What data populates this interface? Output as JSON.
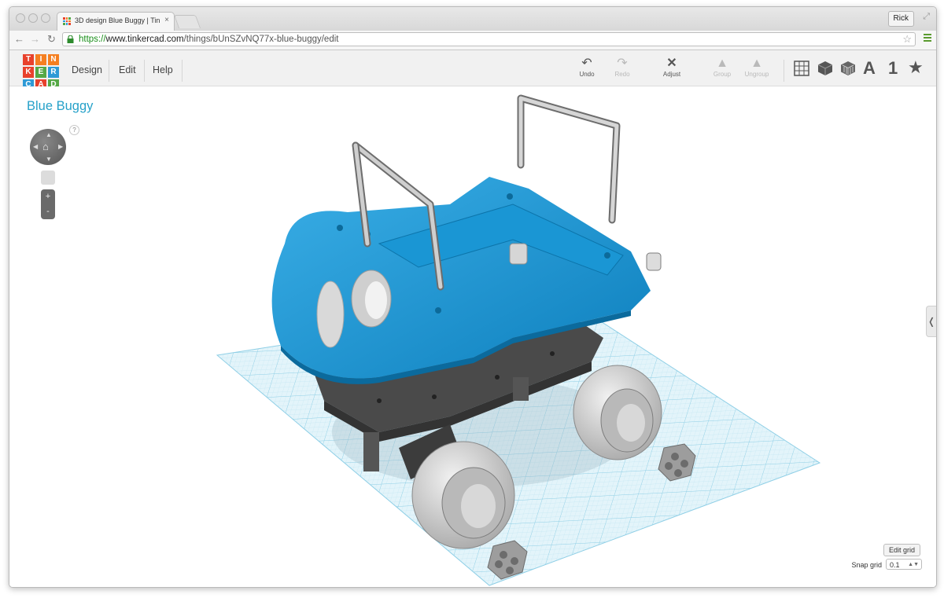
{
  "browser": {
    "tab_title": "3D design Blue Buggy | Tin",
    "tab_close": "×",
    "user": "Rick",
    "url_scheme": "https://",
    "url_host": "www.tinkercad.com",
    "url_path": "/things/bUnSZvNQ77x-blue-buggy/edit"
  },
  "logo": {
    "letters": [
      "T",
      "I",
      "N",
      "K",
      "E",
      "R",
      "C",
      "A",
      "D"
    ],
    "colors": [
      "#e8412c",
      "#f57f21",
      "#f57f21",
      "#e8412c",
      "#55a845",
      "#2e9ad6",
      "#2e9ad6",
      "#e8412c",
      "#55a845"
    ]
  },
  "menu": {
    "design": "Design",
    "edit": "Edit",
    "help": "Help"
  },
  "tools": {
    "undo": "Undo",
    "redo": "Redo",
    "adjust": "Adjust",
    "group": "Group",
    "ungroup": "Ungroup"
  },
  "view_tools": {
    "text_tool": "A",
    "number_tool": "1"
  },
  "design": {
    "title": "Blue Buggy"
  },
  "viewport": {
    "help": "?",
    "zoom_in": "+",
    "zoom_out": "-",
    "side_handle": "❬"
  },
  "grid": {
    "edit_label": "Edit grid",
    "snap_label": "Snap grid",
    "snap_value": "0.1"
  },
  "colors": {
    "accent": "#26a1c9",
    "body_blue": "#1a96d4",
    "grid": "#bfe6f3"
  }
}
